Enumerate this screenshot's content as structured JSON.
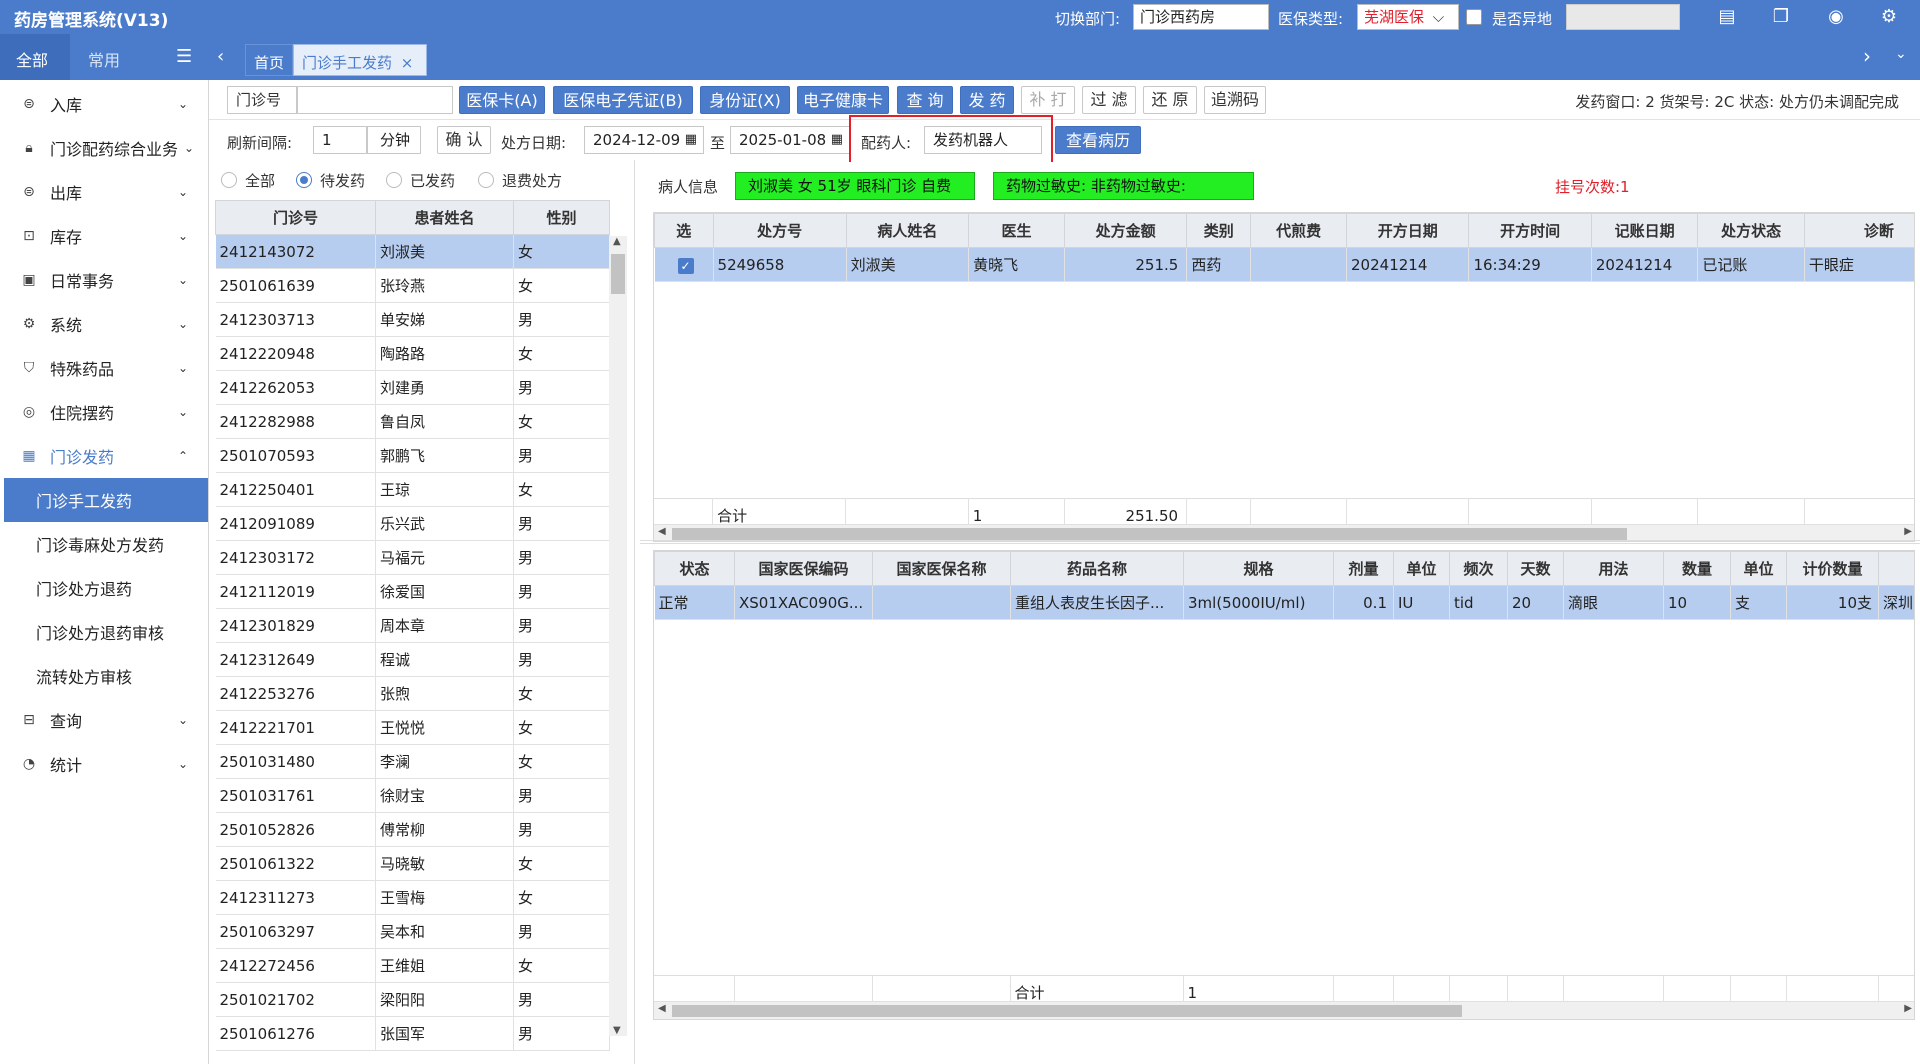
{
  "app": {
    "title": "药房管理系统(V13)"
  },
  "topbar": {
    "dept_label": "切换部门:",
    "dept_value": "门诊西药房",
    "insurance_label": "医保类型:",
    "insurance_value": "芜湖医保",
    "remote_label": "是否异地"
  },
  "sidebar": {
    "tabs": [
      "全部",
      "常用"
    ],
    "items": [
      {
        "label": "入库",
        "icon": "inbound-icon"
      },
      {
        "label": "门诊配药综合业务",
        "icon": "lock-icon"
      },
      {
        "label": "出库",
        "icon": "outbound-icon"
      },
      {
        "label": "库存",
        "icon": "stock-icon"
      },
      {
        "label": "日常事务",
        "icon": "daily-icon"
      },
      {
        "label": "系统",
        "icon": "gear-icon"
      },
      {
        "label": "特殊药品",
        "icon": "special-icon"
      },
      {
        "label": "住院摆药",
        "icon": "inpatient-icon"
      },
      {
        "label": "门诊发药",
        "icon": "dispense-icon"
      }
    ],
    "sub_items": [
      "门诊手工发药",
      "门诊毒麻处方发药",
      "门诊处方退药",
      "门诊处方退药审核",
      "流转处方审核"
    ],
    "items_after": [
      {
        "label": "查询",
        "icon": "query-icon"
      },
      {
        "label": "统计",
        "icon": "stats-icon"
      }
    ]
  },
  "tabs": {
    "home": "首页",
    "current": "门诊手工发药"
  },
  "toolbar": {
    "clinic_label": "门诊号",
    "clinic_value": "",
    "buttons": [
      "医保卡(A)",
      "医保电子凭证(B)",
      "身份证(X)",
      "电子健康卡",
      "查 询",
      "发 药"
    ],
    "reprint": "补 打",
    "filter": "过 滤",
    "restore": "还 原",
    "trace": "追溯码",
    "status_text": "发药窗口: 2  货架号: 2C  状态: 处方仍未调配完成"
  },
  "row2": {
    "refresh_label": "刷新间隔:",
    "refresh_value": "1",
    "minute_unit": "分钟",
    "confirm": "确 认",
    "date_label": "处方日期:",
    "date_from": "2024-12-09",
    "to": "至",
    "date_to": "2025-01-08",
    "pharmacist_label": "配药人:",
    "pharmacist_value": "发药机器人",
    "view_record": "查看病历"
  },
  "filters": {
    "all": "全部",
    "pending": "待发药",
    "dispensed": "已发药",
    "refund": "退费处方"
  },
  "patient_list": {
    "headers": [
      "门诊号",
      "患者姓名",
      "性别"
    ],
    "rows": [
      [
        "2412143072",
        "刘淑美",
        "女"
      ],
      [
        "2501061639",
        "张玲燕",
        "女"
      ],
      [
        "2412303713",
        "单安娣",
        "男"
      ],
      [
        "2412220948",
        "陶路路",
        "女"
      ],
      [
        "2412262053",
        "刘建勇",
        "男"
      ],
      [
        "2412282988",
        "鲁自凤",
        "女"
      ],
      [
        "2501070593",
        "郭鹏飞",
        "男"
      ],
      [
        "2412250401",
        "王琼",
        "女"
      ],
      [
        "2412091089",
        "乐兴武",
        "男"
      ],
      [
        "2412303172",
        "马福元",
        "男"
      ],
      [
        "2412112019",
        "徐爱国",
        "男"
      ],
      [
        "2412301829",
        "周本章",
        "男"
      ],
      [
        "2412312649",
        "程诚",
        "男"
      ],
      [
        "2412253276",
        "张煦",
        "女"
      ],
      [
        "2412221701",
        "王悦悦",
        "女"
      ],
      [
        "2501031480",
        "李澜",
        "女"
      ],
      [
        "2501031761",
        "徐财宝",
        "男"
      ],
      [
        "2501052826",
        "傅常柳",
        "男"
      ],
      [
        "2501061322",
        "马晓敏",
        "女"
      ],
      [
        "2412311273",
        "王雪梅",
        "女"
      ],
      [
        "2501063297",
        "吴本和",
        "男"
      ],
      [
        "2412272456",
        "王维姐",
        "女"
      ],
      [
        "2501021702",
        "梁阳阳",
        "男"
      ],
      [
        "2501061276",
        "张国军",
        "男"
      ]
    ]
  },
  "patient_info": {
    "label": "病人信息",
    "summary": "刘淑美  女 51岁 眼科门诊 自费",
    "allergy": "药物过敏史:        非药物过敏史:",
    "registrations": "挂号次数:1"
  },
  "prescriptions": {
    "headers": [
      "选",
      "处方号",
      "病人姓名",
      "医生",
      "处方金额",
      "类别",
      "代煎费",
      "开方日期",
      "开方时间",
      "记账日期",
      "处方状态",
      "诊断"
    ],
    "rows": [
      [
        "✓",
        "5249658",
        "刘淑美",
        "黄晓飞",
        "251.5",
        "西药",
        "",
        "20241214",
        "16:34:29",
        "20241214",
        "已记账",
        "干眼症"
      ]
    ],
    "total_label": "合计",
    "total_count": "1",
    "total_amount": "251.50"
  },
  "drugs": {
    "headers": [
      "状态",
      "国家医保编码",
      "国家医保名称",
      "药品名称",
      "规格",
      "剂量",
      "单位",
      "频次",
      "天数",
      "用法",
      "数量",
      "单位",
      "计价数量"
    ],
    "rows": [
      [
        "正常",
        "XS01XAC090G...",
        "",
        "重组人表皮生长因子...",
        "3ml(5000IU/ml)",
        "0.1",
        "IU",
        "tid",
        "20",
        "滴眼",
        "10",
        "支",
        "10支"
      ]
    ],
    "overflow_cell": "深圳",
    "total_label": "合计",
    "total_count": "1"
  }
}
